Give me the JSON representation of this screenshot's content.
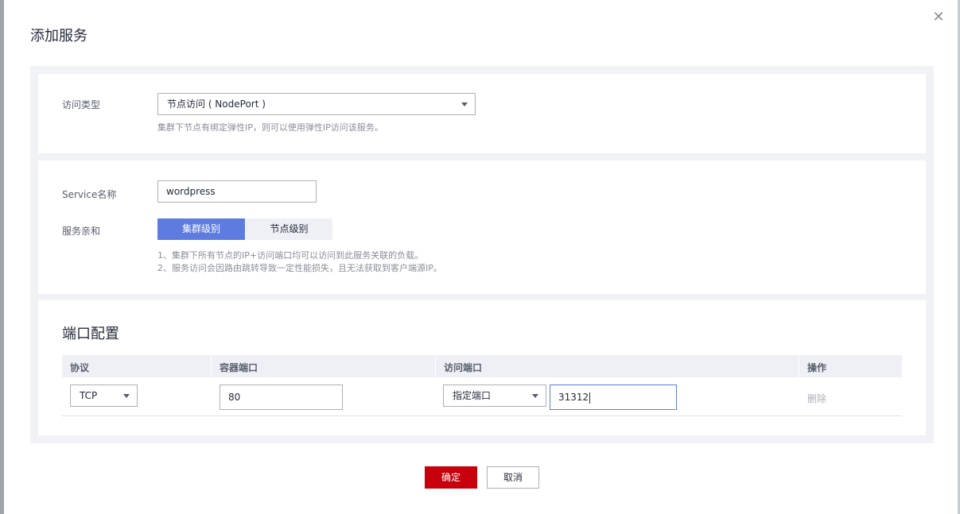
{
  "dialog": {
    "title": "添加服务",
    "close_icon": "close-icon"
  },
  "access": {
    "type_label": "访问类型",
    "type_value": "节点访问 ( NodePort )",
    "hint": "集群下节点有绑定弹性IP，则可以使用弹性IP访问该服务。"
  },
  "service": {
    "name_label": "Service名称",
    "name_value": "wordpress",
    "affinity_label": "服务亲和",
    "affinity_options": [
      "集群级别",
      "节点级别"
    ],
    "affinity_selected": "集群级别",
    "hint_line1": "1、集群下所有节点的IP+访问端口均可以访问到此服务关联的负载。",
    "hint_line2": "2、服务访问会因路由跳转导致一定性能损失，且无法获取到客户端源IP。"
  },
  "ports": {
    "title": "端口配置",
    "headers": [
      "协议",
      "容器端口",
      "访问端口",
      "操作"
    ],
    "rows": [
      {
        "protocol": "TCP",
        "container_port": "80",
        "access_port_mode": "指定端口",
        "access_port": "31312",
        "action": "删除"
      }
    ]
  },
  "footer": {
    "confirm_label": "确定",
    "cancel_label": "取消"
  },
  "colors": {
    "primary": "#5e7ce0",
    "confirm": "#c7000b",
    "segment_inactive": "#eef0f5",
    "panel_bg": "#f0f2f5"
  }
}
